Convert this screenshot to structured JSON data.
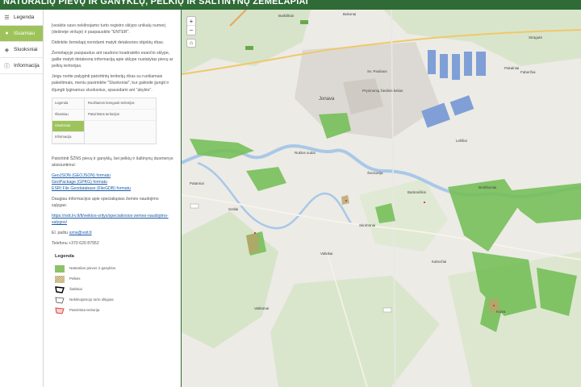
{
  "app": {
    "title": "NATŪRALIŲ PIEVŲ IR GANYKLŲ, PELKIŲ IR ŠALTINYNŲ ŽEMĖLAPIAI"
  },
  "nav": {
    "items": [
      {
        "label": "Legenda",
        "icon": "list-icon"
      },
      {
        "label": "Išsamiau",
        "icon": "info-dot-icon",
        "active": true
      },
      {
        "label": "Sluoksniai",
        "icon": "layers-icon"
      },
      {
        "label": "Informacija",
        "icon": "info-icon"
      }
    ]
  },
  "panel": {
    "p1": "Įveskite savo nekilnojamo turto registro sklypo unikalų numerį (dešinėje viršuje) ir paspauskite \"ENTER\".",
    "p2": "Didinkite žemėlapį norėdami matyti detalesnes objektų ribas.",
    "p3": "Žemėlapyje paspaudus ant raudono kvadratėlio esančio sklype, galite matyti detalesnę informaciją apie sklype nustatytas pievų ar pelkių teritorijas.",
    "p4": "Jeigu norite palyginti patvirtintų teritorijų ribas su ruošiamais pakeitimais, meniu pasirinkite \"Sluoksniai\", kur galėsite įjungti ir išjungti lyginamus sluoksnius, spausdami ant \"akytės\".",
    "thumb": {
      "nav": [
        "Legenda",
        "Išsamiau",
        "Sluoksniai",
        "Informacija"
      ],
      "rows": [
        "Ruošiamos koreguoti teritorijos",
        "Patvirtintos teritorijos"
      ]
    },
    "p5": "Patvirtinti ŠŽNS pievų ir ganyklų, bei pelkių ir šaltinynų duomenys atsisiuntimui:",
    "links": [
      "GeoJSON (GEOJSON) formatu",
      "GeoPackage (GPKG) formatu",
      "ESRI File Geodatabase (FileGDB) formatu"
    ],
    "p6": "Daugiau informacijos apie specialiąsias žemės naudojimo sąlygas:",
    "link_more": "https://vstt.lrv.lt/lt/veiklos-sritys/specialiosios-zemes-naudojimo-salygos/",
    "email_label": "El. paštu",
    "email": "szns@vstt.lt",
    "phone": "Telefonu +370 620 87952"
  },
  "legend": {
    "title": "Legenda",
    "items": [
      {
        "label": "Natūralios pievos ir ganyklos",
        "color": "#8dc26a"
      },
      {
        "label": "Pelkės",
        "color": "#b8a26a"
      },
      {
        "label": "Šaltiniai",
        "color": "#000000"
      },
      {
        "label": "Nekilnojamojo turto sklypas",
        "color": "#555555"
      },
      {
        "label": "Patvirtinta teritorija",
        "color": "#d9443a"
      }
    ]
  },
  "map": {
    "labels": [
      "Butkiškiai",
      "Bukonai",
      "Stragutė",
      "Pakalniai",
      "Faberžiai",
      "Jonava",
      "Žeimių g.",
      "Prysmonių žiedinis kelias",
      "Sv. Pauliaus",
      "Ruklos sodai",
      "Lelišiai",
      "Kiškiai",
      "Šveicarija",
      "Brokštoniai",
      "Naujasodžiai",
      "Kulva",
      "Barkūniškis",
      "Paviliai",
      "Skrebūnai",
      "Valiūkai",
      "Vaitkūnai",
      "Mūreliai",
      "Patarniai",
      "Sotilai",
      "Gaižiūnai",
      "Kalnočiai",
      "Klaipėdiškiai",
      "Upninkai",
      "Mitališkiai",
      "Laukšagiai",
      "Jankiškės"
    ],
    "roads": [
      "144",
      "A6",
      "1703",
      "1702",
      "1928",
      "A6",
      "45-06",
      "45-14",
      "45-63",
      "45-39"
    ]
  }
}
